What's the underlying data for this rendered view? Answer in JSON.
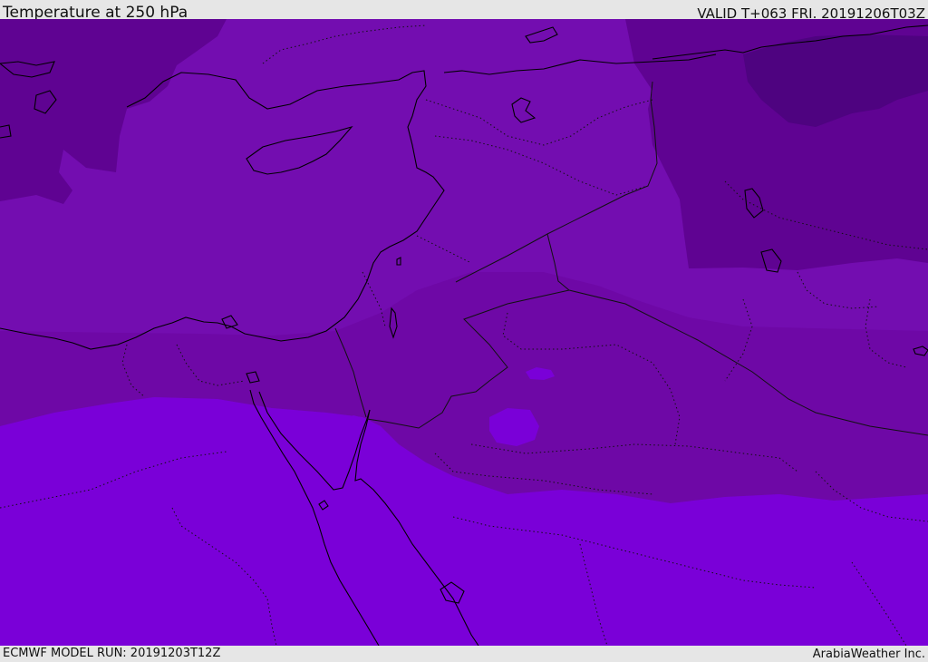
{
  "header": {
    "title": "Temperature at 250 hPa",
    "valid": "VALID T+063 FRI. 20191206T03Z"
  },
  "footer": {
    "model_run": "ECMWF MODEL RUN: 20191203T12Z",
    "credit": "ArabiaWeather Inc."
  },
  "map": {
    "region": "Eastern Mediterranean, Levant, Egypt and Northern Arabia",
    "colors": {
      "coldest": "#4e0380",
      "cold": "#5f0392",
      "cool": "#6e08a6",
      "mid": "#730db0",
      "warm": "#7a00d8",
      "coastline": "#000000",
      "border": "#111111"
    }
  }
}
